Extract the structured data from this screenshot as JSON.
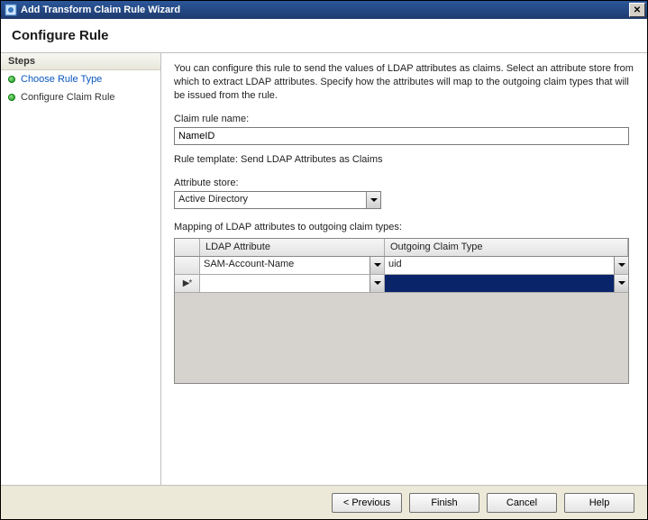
{
  "window": {
    "title": "Add Transform Claim Rule Wizard"
  },
  "page": {
    "heading": "Configure Rule"
  },
  "sidebar": {
    "steps_label": "Steps",
    "items": [
      {
        "label": "Choose Rule Type",
        "state": "link"
      },
      {
        "label": "Configure Claim Rule",
        "state": "current"
      }
    ]
  },
  "main": {
    "description": "You can configure this rule to send the values of LDAP attributes as claims. Select an attribute store from which to extract LDAP attributes. Specify how the attributes will map to the outgoing claim types that will be issued from the rule.",
    "claim_rule_name_label": "Claim rule name:",
    "claim_rule_name_value": "NameID",
    "rule_template_line": "Rule template: Send LDAP Attributes as Claims",
    "attribute_store_label": "Attribute store:",
    "attribute_store_value": "Active Directory",
    "mapping_label": "Mapping of LDAP attributes to outgoing claim types:",
    "grid": {
      "headers": {
        "ldap": "LDAP Attribute",
        "claim": "Outgoing Claim Type"
      },
      "rows": [
        {
          "ldap": "SAM-Account-Name",
          "claim": "uid",
          "selector": ""
        },
        {
          "ldap": "",
          "claim": "",
          "selector": "new"
        }
      ]
    }
  },
  "footer": {
    "previous": "< Previous",
    "finish": "Finish",
    "cancel": "Cancel",
    "help": "Help"
  }
}
